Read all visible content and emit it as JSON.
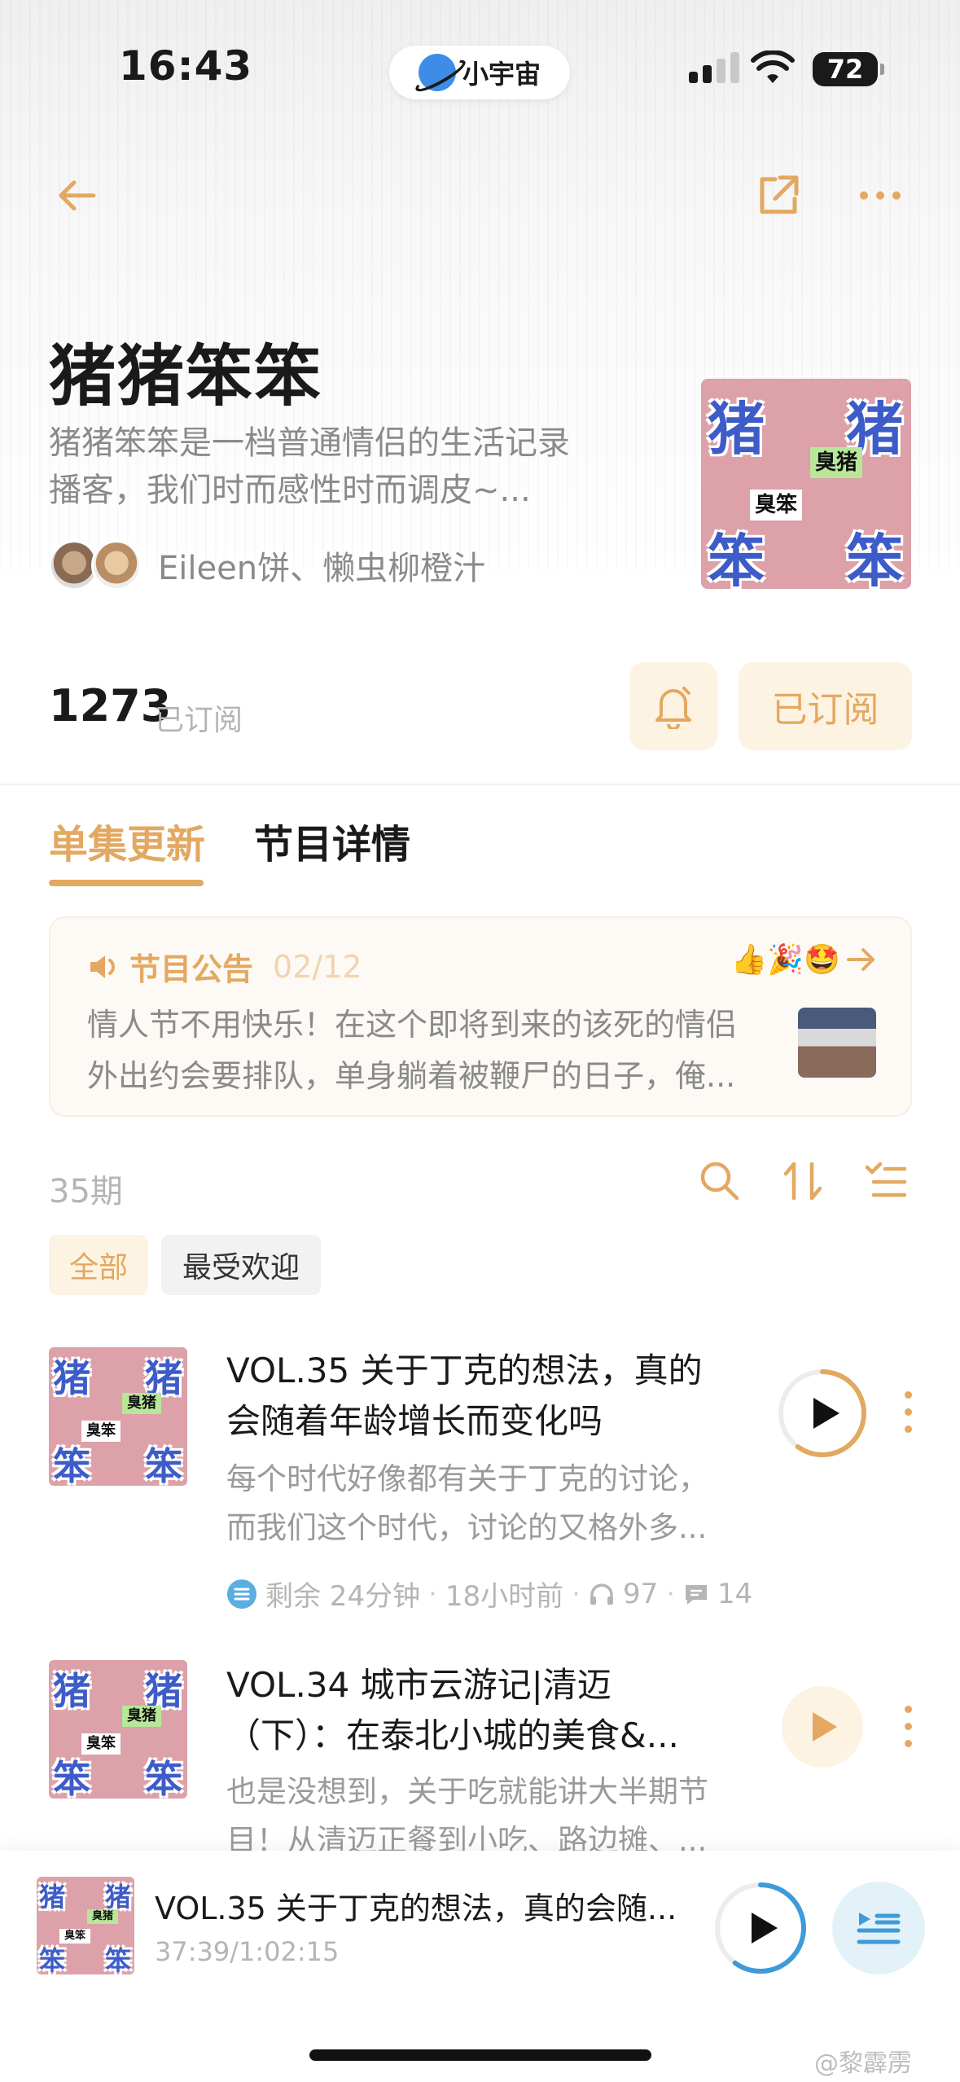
{
  "status_bar": {
    "time": "16:43",
    "island_app": "小宇宙",
    "battery": "72"
  },
  "nav": {
    "back_icon": "arrow-left-icon",
    "share_icon": "share-icon",
    "more_icon": "more-horizontal-icon"
  },
  "podcast": {
    "title": "猪猪笨笨",
    "description_line1": "猪猪笨笨是一档普通情侣的生活记录",
    "description_line2": "播客，我们时而感性时而调皮~...",
    "authors": "Eileen饼、懒虫柳橙汁",
    "cover": {
      "char1": "猪",
      "char2": "猪",
      "char3": "笨",
      "char4": "笨",
      "tag1": "臭猪",
      "tag2": "臭笨"
    }
  },
  "subscription": {
    "count": "1273",
    "label": "已订阅",
    "button": "已订阅"
  },
  "tabs": [
    {
      "label": "单集更新"
    },
    {
      "label": "节目详情"
    }
  ],
  "announcement": {
    "title": "节目公告",
    "date": "02/12",
    "emojis": "👍🎉🤩",
    "text_line1": "情人节不用快乐！在这个即将到来的该死的情侣",
    "text_line2": "外出约会要排队，单身躺着被鞭尸的日子，俺..."
  },
  "list": {
    "count": "35期",
    "filters": [
      {
        "label": "全部"
      },
      {
        "label": "最受欢迎"
      }
    ]
  },
  "episodes": [
    {
      "title_line1": "VOL.35 关于丁克的想法，真的",
      "title_line2": "会随着年龄增长而变化吗",
      "desc_line1": "每个时代好像都有关于丁克的讨论，",
      "desc_line2": "而我们这个时代，讨论的又格外多...",
      "remaining": "剩余 24分钟",
      "posted": "18小时前",
      "plays": "97",
      "comments": "14",
      "progress": 0.6
    },
    {
      "title_line1": "VOL.34 城市云游记|清迈",
      "title_line2": "（下）：在泰北小城的美食&...",
      "desc_line1": "也是没想到，关于吃就能讲大半期节",
      "desc_line2": "目！从清迈正餐到小吃、路边摊、..."
    }
  ],
  "player": {
    "title": "VOL.35 关于丁克的想法，真的会随...",
    "time": "37:39/1:02:15",
    "progress": 0.6
  },
  "watermark": "@黎霹雳",
  "colors": {
    "accent": "#e3a861",
    "accent_bg": "#fdf3e3",
    "player_blue": "#3d9bd8",
    "cover_pink": "#dca1a9",
    "cover_blue": "#3d5cc7"
  }
}
